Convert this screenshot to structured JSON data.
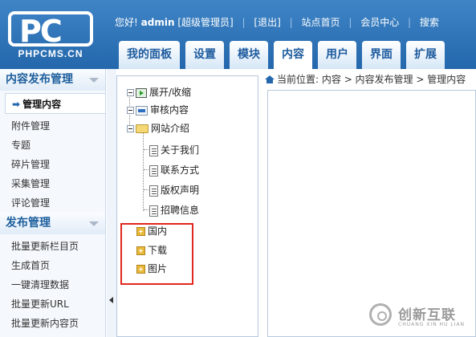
{
  "logo": {
    "main": "PC",
    "sub": "PHPCMS.CN"
  },
  "topbar": {
    "greeting": "您好!",
    "username": "admin",
    "role": "[超级管理员]",
    "logout": "[退出]",
    "site_home": "站点首页",
    "member_center": "会员中心",
    "search": "搜索"
  },
  "tabs": [
    {
      "label": "我的面板"
    },
    {
      "label": "设置"
    },
    {
      "label": "模块"
    },
    {
      "label": "内容",
      "active": true
    },
    {
      "label": "用户"
    },
    {
      "label": "界面"
    },
    {
      "label": "扩展"
    }
  ],
  "sidebar": {
    "group1": {
      "title": "内容发布管理",
      "items": [
        "管理内容",
        "附件管理",
        "专题",
        "碎片管理",
        "采集管理",
        "评论管理"
      ]
    },
    "group2": {
      "title": "发布管理",
      "items": [
        "批量更新栏目页",
        "生成首页",
        "一键清理数据",
        "批量更新URL",
        "批量更新内容页"
      ]
    }
  },
  "tree": {
    "toggle_all": "展开/收缩",
    "review": "审核内容",
    "site_intro": "网站介绍",
    "site_children": [
      "关于我们",
      "联系方式",
      "版权声明",
      "招聘信息"
    ],
    "categories": [
      "国内",
      "下载",
      "图片"
    ]
  },
  "breadcrumb": {
    "label": "当前位置:",
    "path": "内容 > 内容发布管理 > 管理内容"
  },
  "watermark": {
    "cn": "创新互联",
    "en": "CHUANG XIN HU LIAN"
  },
  "colors": {
    "header_blue": "#2467ac",
    "highlight_red": "#e0281e"
  }
}
